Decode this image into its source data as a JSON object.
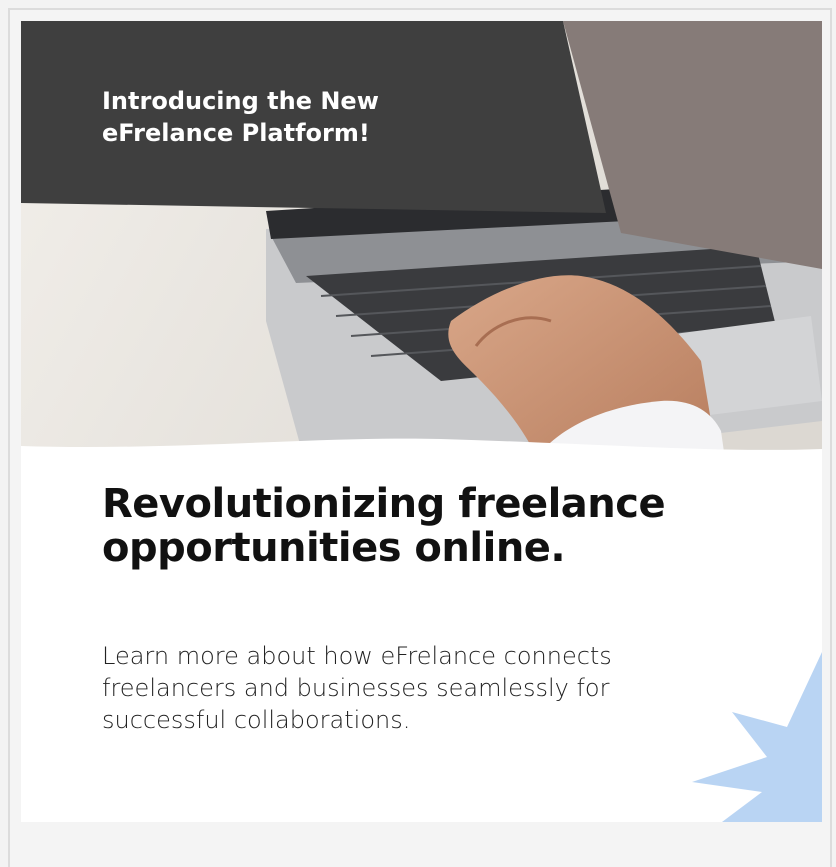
{
  "banner": {
    "intro_text": "Introducing the New eFrelance Platform!",
    "headline": "Revolutionizing freelance opportunities online.",
    "description": "Learn more about how eFrelance connects freelancers and businesses seamlessly for successful collaborations."
  },
  "colors": {
    "dark_panel": "#3f3f3f",
    "taupe_panel": "#867b78",
    "accent_burst": "#b9d4f3",
    "headline_text": "#111111"
  },
  "icons": {
    "accent": "starburst-shape"
  }
}
